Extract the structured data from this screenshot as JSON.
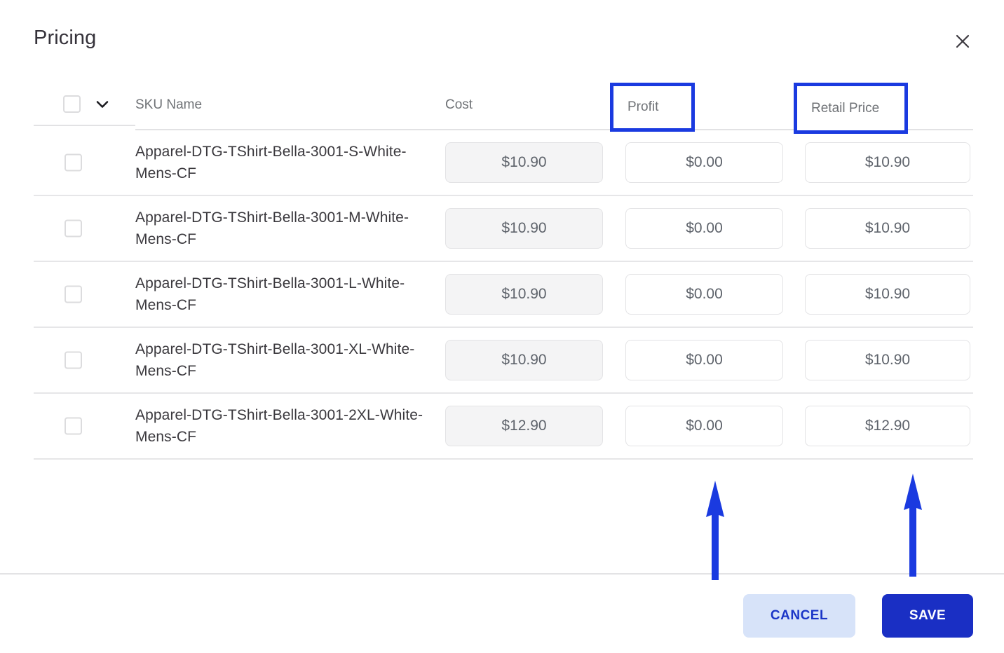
{
  "dialog": {
    "title": "Pricing",
    "close_icon": "close-icon"
  },
  "table": {
    "headers": {
      "select_all": "",
      "sku_name": "SKU Name",
      "cost": "Cost",
      "profit": "Profit",
      "retail_price": "Retail Price"
    },
    "rows": [
      {
        "sku": "Apparel-DTG-TShirt-Bella-3001-S-White-Mens-CF",
        "cost": "$10.90",
        "profit": "$0.00",
        "retail": "$10.90"
      },
      {
        "sku": "Apparel-DTG-TShirt-Bella-3001-M-White-Mens-CF",
        "cost": "$10.90",
        "profit": "$0.00",
        "retail": "$10.90"
      },
      {
        "sku": "Apparel-DTG-TShirt-Bella-3001-L-White-Mens-CF",
        "cost": "$10.90",
        "profit": "$0.00",
        "retail": "$10.90"
      },
      {
        "sku": "Apparel-DTG-TShirt-Bella-3001-XL-White-Mens-CF",
        "cost": "$10.90",
        "profit": "$0.00",
        "retail": "$10.90"
      },
      {
        "sku": "Apparel-DTG-TShirt-Bella-3001-2XL-White-Mens-CF",
        "cost": "$12.90",
        "profit": "$0.00",
        "retail": "$12.90"
      }
    ]
  },
  "annotations": {
    "highlight_color": "#1a3ae0",
    "arrow_color": "#1a3ae0",
    "highlighted_columns": [
      "Profit",
      "Retail Price"
    ]
  },
  "footer": {
    "cancel_label": "CANCEL",
    "save_label": "SAVE",
    "cancel_bg": "#d7e3f9",
    "save_bg": "#1a2fc4"
  }
}
